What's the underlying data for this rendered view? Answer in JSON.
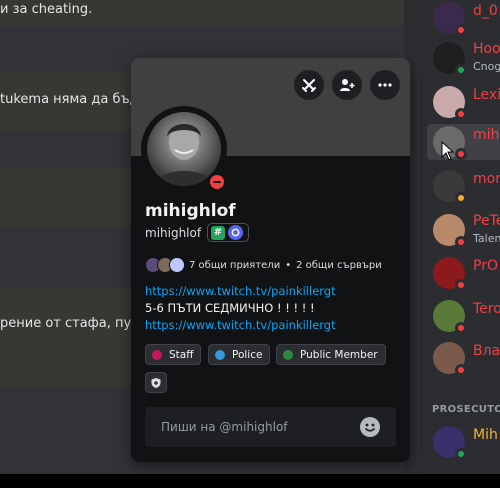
{
  "chat": {
    "messages": [
      "и за cheating.",
      "tukema няма да бъд",
      "",
      "рение от стафа, пу"
    ]
  },
  "members": {
    "items": [
      {
        "name": "d_0",
        "sub": "",
        "color": "#f23f43",
        "status": "dnd"
      },
      {
        "name": "Hoo",
        "sub": "Cnog",
        "color": "#f23f43",
        "status": "online"
      },
      {
        "name": "Lexi",
        "sub": "",
        "color": "#f23f43",
        "status": "dnd"
      },
      {
        "name": "mih",
        "sub": "",
        "color": "#f23f43",
        "status": "dnd"
      },
      {
        "name": "mor",
        "sub": "",
        "color": "#f23f43",
        "status": "idle"
      },
      {
        "name": "PeTe",
        "sub": "Talen",
        "color": "#f23f43",
        "status": "dnd"
      },
      {
        "name": "PrO",
        "sub": "",
        "color": "#f23f43",
        "status": "dnd"
      },
      {
        "name": "Tero",
        "sub": "",
        "color": "#f23f43",
        "status": "dnd"
      },
      {
        "name": "Вла",
        "sub": "",
        "color": "#f23f43",
        "status": "dnd"
      }
    ],
    "section_header": "PROSECUTO",
    "section_member": {
      "name": "Mih",
      "color": "#f0b232",
      "status": "online"
    }
  },
  "profile": {
    "display_name": "mihighlof",
    "username": "mihighlof",
    "badge_hash": "#",
    "mutual_friends": "7 общи приятели",
    "separator": "•",
    "mutual_servers": "2 общи сървъри",
    "link1": "https://www.twitch.tv/painkillergt",
    "bio_line": "5-6 ПЪТИ СЕДМИЧНО ! ! ! ! !",
    "link2": "https://www.twitch.tv/painkillergt",
    "roles": [
      {
        "label": "Staff",
        "color": "#c2185b"
      },
      {
        "label": "Police",
        "color": "#3498db"
      },
      {
        "label": "Public Member",
        "color": "#2e8b3e"
      }
    ],
    "message_placeholder": "Пиши на @mihighlof"
  },
  "icons": {
    "banner_buttons": [
      "swords-icon",
      "add-friend-icon",
      "more-icon"
    ],
    "status": "do-not-disturb-icon",
    "add_role": "shield-icon",
    "emoji": "emoji-icon"
  },
  "colors": {
    "link": "#00a8fc",
    "dnd": "#f23f43",
    "online": "#23a559",
    "idle": "#f0b232"
  }
}
